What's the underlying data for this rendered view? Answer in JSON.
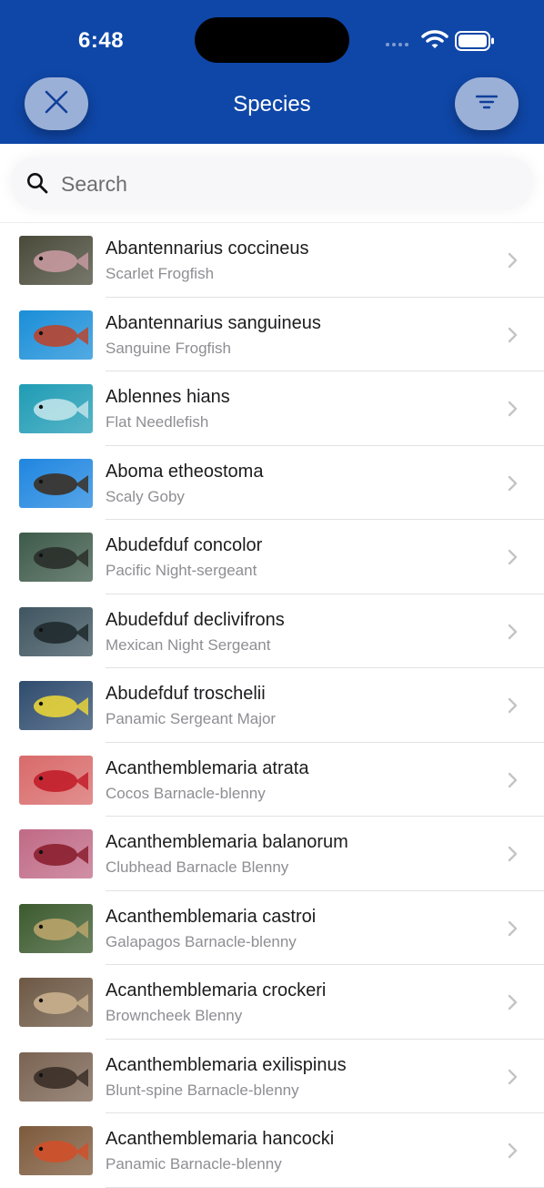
{
  "status_bar": {
    "time": "6:48"
  },
  "nav": {
    "title": "Species",
    "close_icon": "close-icon",
    "filter_icon": "filter-icon"
  },
  "search": {
    "placeholder": "Search",
    "value": ""
  },
  "species": [
    {
      "scientific": "Abantennarius coccineus",
      "common": "Scarlet Frogfish",
      "thumb_colors": [
        "#4a4a3a",
        "#c69aa0"
      ]
    },
    {
      "scientific": "Abantennarius sanguineus",
      "common": "Sanguine Frogfish",
      "thumb_colors": [
        "#1a8ed8",
        "#b8452f"
      ]
    },
    {
      "scientific": "Ablennes hians",
      "common": "Flat Needlefish",
      "thumb_colors": [
        "#1f9cb5",
        "#bfe3ea"
      ]
    },
    {
      "scientific": "Aboma etheostoma",
      "common": "Scaly Goby",
      "thumb_colors": [
        "#1f86e0",
        "#3a3026"
      ]
    },
    {
      "scientific": "Abudefduf concolor",
      "common": "Pacific Night-sergeant",
      "thumb_colors": [
        "#3d5a4a",
        "#2a2f2a"
      ]
    },
    {
      "scientific": "Abudefduf declivifrons",
      "common": "Mexican Night Sergeant",
      "thumb_colors": [
        "#3f5560",
        "#1f2a2c"
      ]
    },
    {
      "scientific": "Abudefduf troschelii",
      "common": "Panamic Sergeant Major",
      "thumb_colors": [
        "#2f4c6e",
        "#e8d43a"
      ]
    },
    {
      "scientific": "Acanthemblemaria atrata",
      "common": "Cocos Barnacle-blenny",
      "thumb_colors": [
        "#d96a6a",
        "#c21e2a"
      ]
    },
    {
      "scientific": "Acanthemblemaria balanorum",
      "common": "Clubhead Barnacle Blenny",
      "thumb_colors": [
        "#c06a86",
        "#8a1f2f"
      ]
    },
    {
      "scientific": "Acanthemblemaria castroi",
      "common": "Galapagos Barnacle-blenny",
      "thumb_colors": [
        "#3b5a2e",
        "#b9a46a"
      ]
    },
    {
      "scientific": "Acanthemblemaria crockeri",
      "common": "Browncheek Blenny",
      "thumb_colors": [
        "#6d5844",
        "#c9b08e"
      ]
    },
    {
      "scientific": "Acanthemblemaria exilispinus",
      "common": "Blunt-spine Barnacle-blenny",
      "thumb_colors": [
        "#7a6352",
        "#3a2f28"
      ]
    },
    {
      "scientific": "Acanthemblemaria hancocki",
      "common": "Panamic Barnacle-blenny",
      "thumb_colors": [
        "#7d5a3c",
        "#d0502a"
      ]
    }
  ]
}
